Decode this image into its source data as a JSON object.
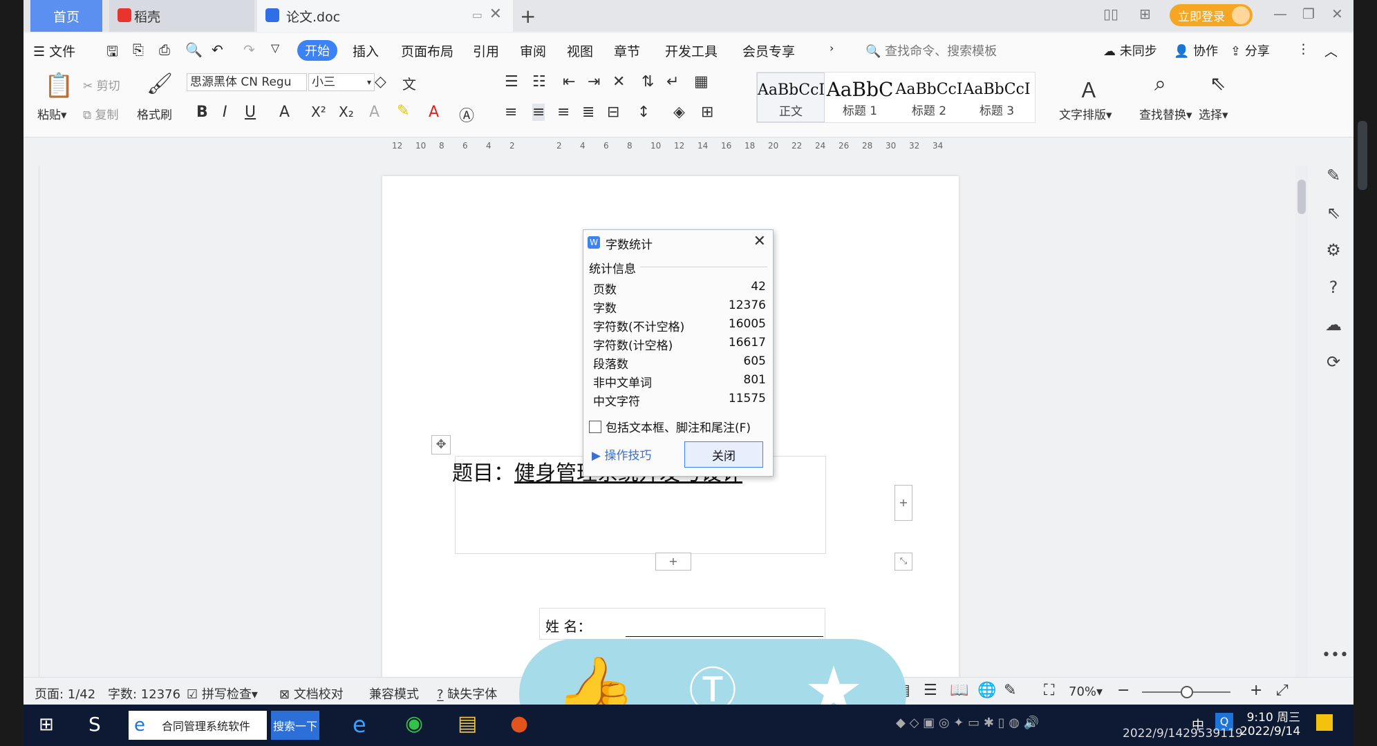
{
  "tabs": {
    "home": "首页",
    "daoke": "稻壳",
    "doc": "论文.doc",
    "add": "+"
  },
  "header": {
    "login": "立即登录"
  },
  "menu": {
    "file": "文件",
    "start": "开始",
    "items": [
      "插入",
      "页面布局",
      "引用",
      "审阅",
      "视图",
      "章节",
      "开发工具",
      "会员专享"
    ],
    "search_placeholder": "查找命令、搜索模板",
    "sync": "未同步",
    "collab": "协作",
    "share": "分享"
  },
  "ribbon": {
    "paste": "粘贴",
    "cut": "剪切",
    "copy": "复制",
    "format_painter": "格式刷",
    "font_name": "思源黑体 CN Regu",
    "font_size": "小三",
    "styles": [
      {
        "preview": "AaBbCcI",
        "name": "正文"
      },
      {
        "preview": "AaBbC",
        "name": "标题 1"
      },
      {
        "preview": "AaBbCcI",
        "name": "标题 2"
      },
      {
        "preview": "AaBbCcI",
        "name": "标题 3"
      }
    ],
    "text_layout": "文字排版",
    "find_replace": "查找替换",
    "select": "选择"
  },
  "ruler": {
    "marks": [
      "12",
      "10",
      "8",
      "6",
      "4",
      "2",
      "",
      "2",
      "4",
      "6",
      "8",
      "10",
      "12",
      "14",
      "16",
      "18",
      "20",
      "22",
      "24",
      "26",
      "28",
      "30",
      "32",
      "34"
    ]
  },
  "document": {
    "title_label": "题目：",
    "title_text": "健身管理系统开发与设计",
    "name_label": "姓      名："
  },
  "dialog": {
    "title": "字数统计",
    "section": "统计信息",
    "rows": [
      {
        "label": "页数",
        "value": "42"
      },
      {
        "label": "字数",
        "value": "12376"
      },
      {
        "label": "字符数(不计空格)",
        "value": "16005"
      },
      {
        "label": "字符数(计空格)",
        "value": "16617"
      },
      {
        "label": "段落数",
        "value": "605"
      },
      {
        "label": "非中文单词",
        "value": "801"
      },
      {
        "label": "中文字符",
        "value": "11575"
      }
    ],
    "include_check": "包括文本框、脚注和尾注(F)",
    "tips": "操作技巧",
    "close": "关闭"
  },
  "status": {
    "page": "页面: 1/42",
    "words": "字数: 12376",
    "spell": "拼写检查",
    "proof": "文档校对",
    "compat": "兼容模式",
    "missing_font": "缺失字体",
    "zoom": "70%"
  },
  "taskbar": {
    "app": "合同管理系统软件",
    "search": "搜索一下",
    "ime": "中",
    "time": "9:10 周三",
    "date": "2022/9/14",
    "watermark": "2022/9/1429539119"
  }
}
